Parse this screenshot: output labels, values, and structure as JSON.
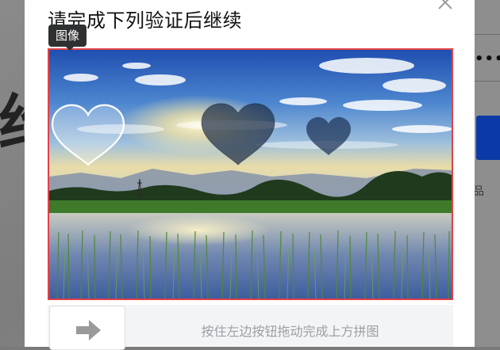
{
  "background": {
    "big_text": "绐",
    "password_mask": "•••",
    "side_char": "品"
  },
  "modal": {
    "title": "请完成下列验证后继续",
    "tooltip": "图像",
    "slider_hint": "按住左边按钮拖动完成上方拼图"
  },
  "icons": {
    "close": "close-icon",
    "slider_arrow": "arrow-right-icon"
  },
  "colors": {
    "image_border": "#e0424a",
    "tooltip_bg": "#2f3031",
    "background_button": "#0b3aa8"
  }
}
